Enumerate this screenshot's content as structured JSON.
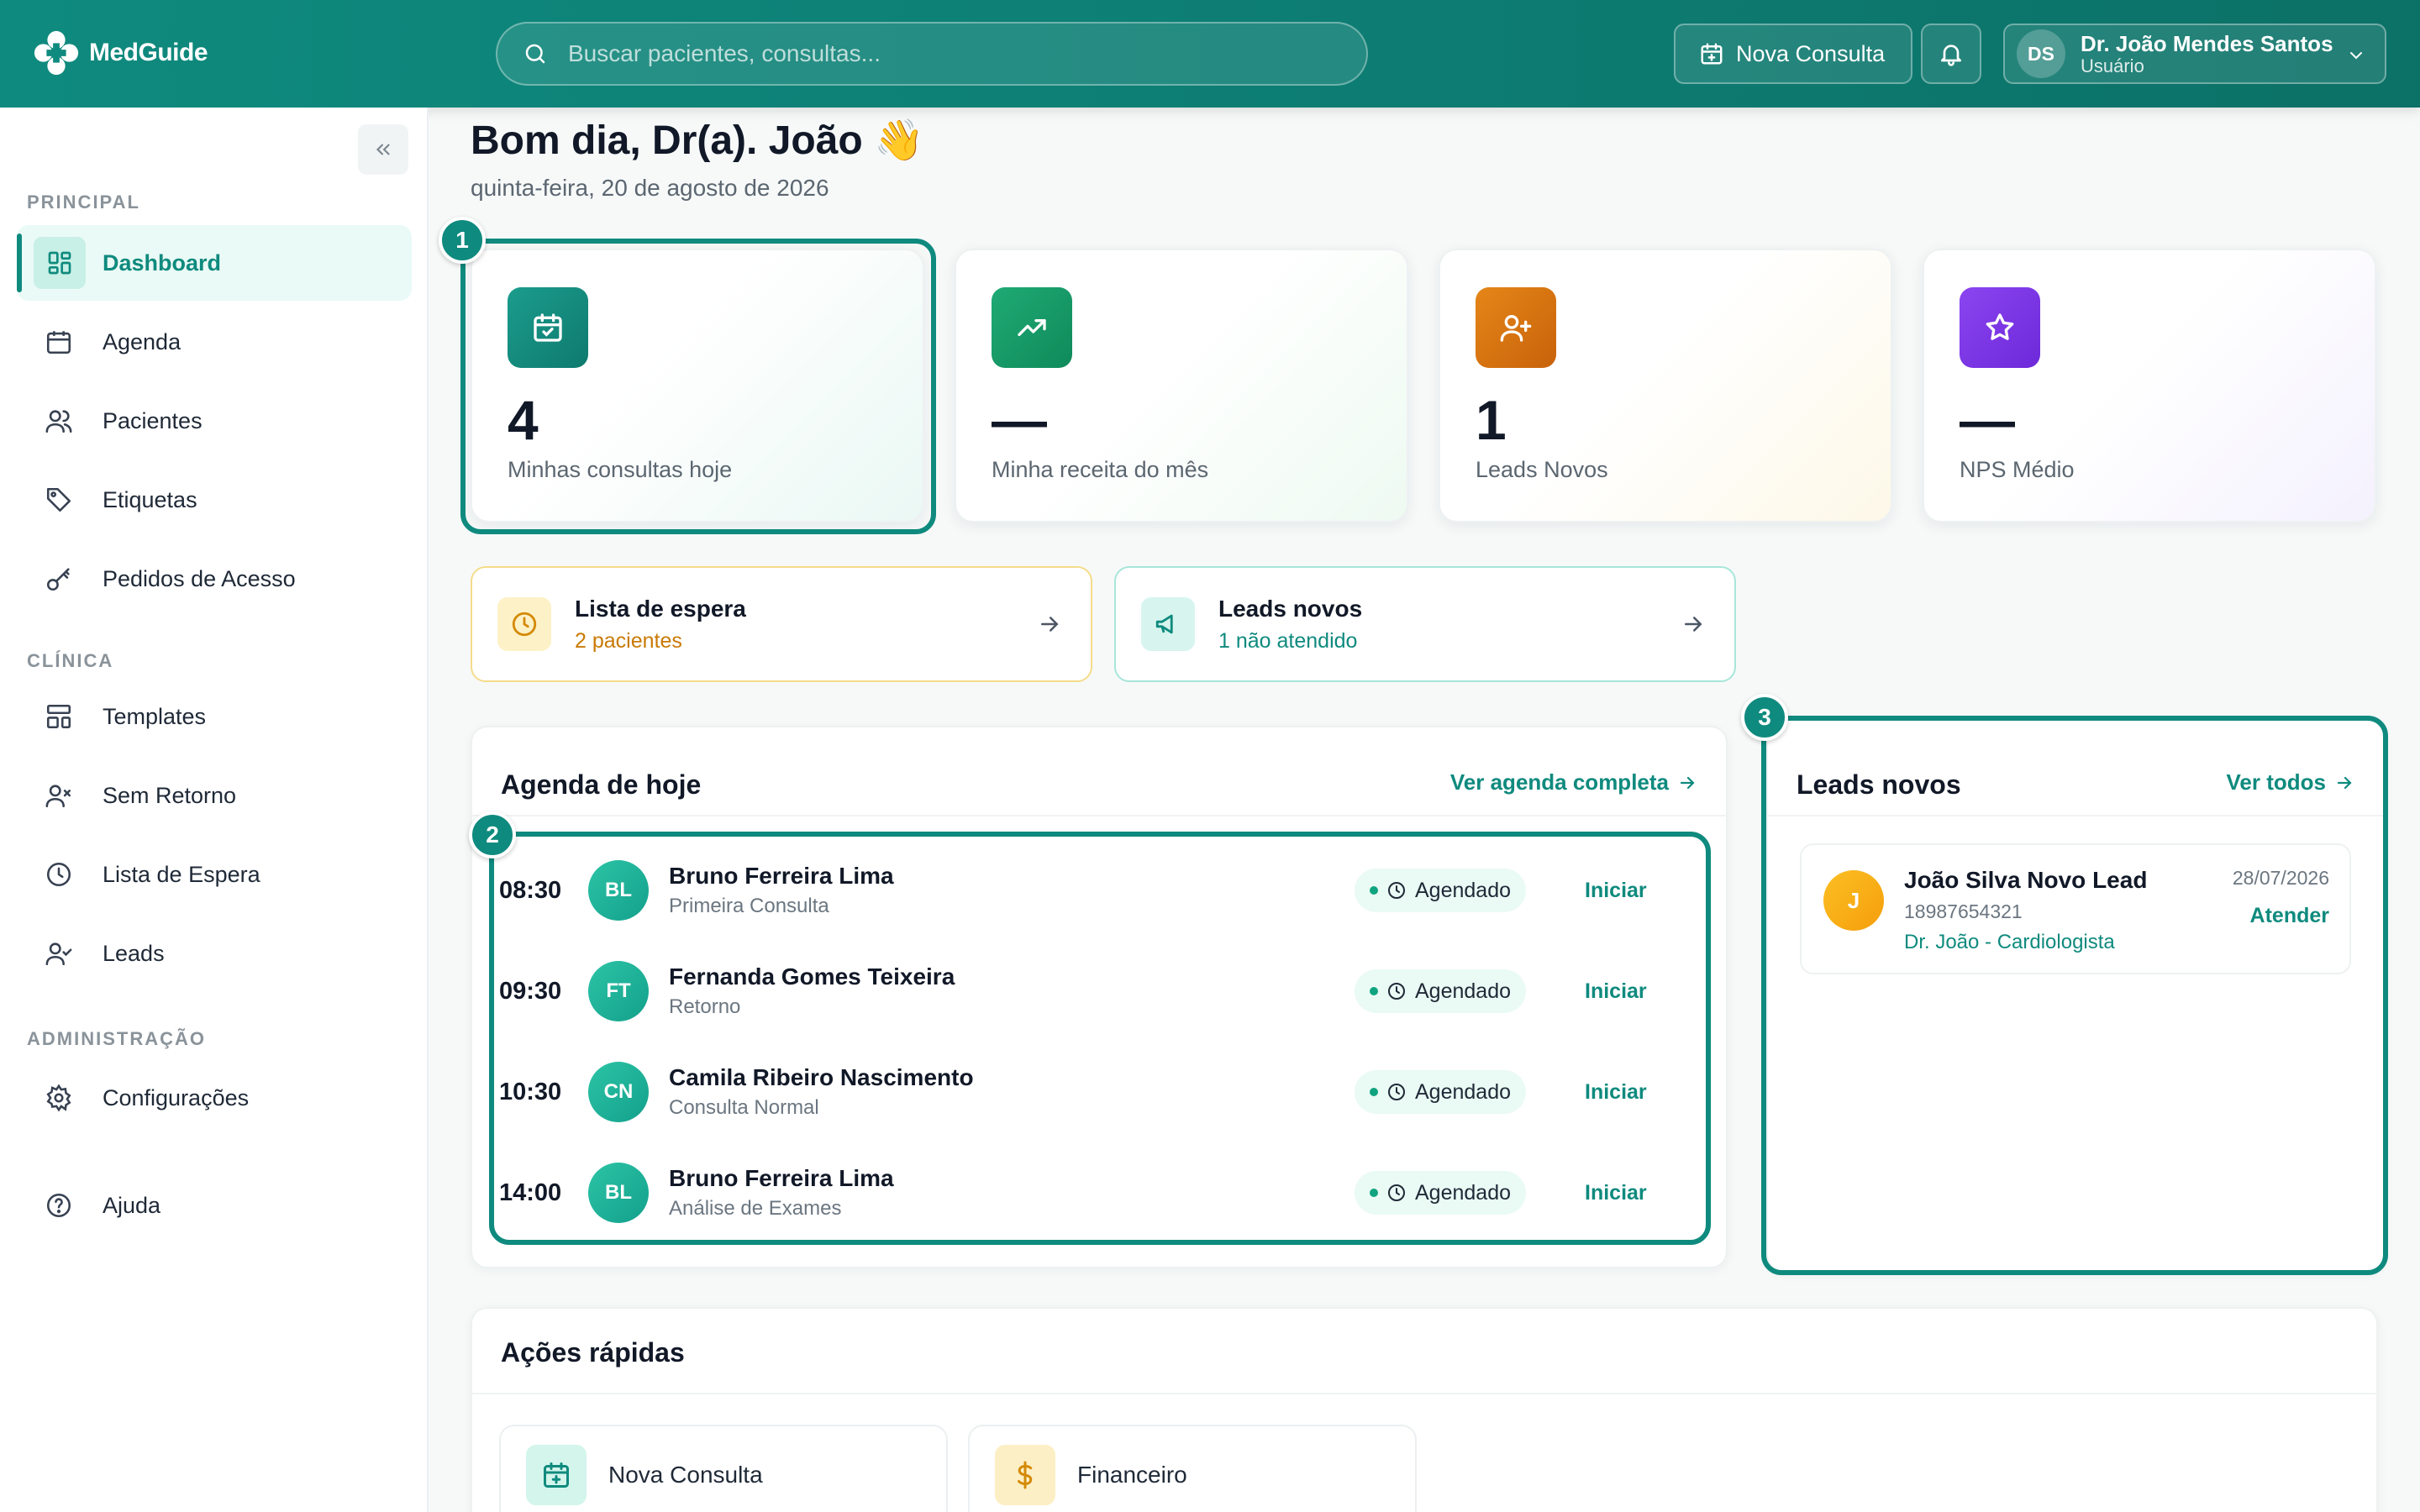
{
  "app": {
    "name": "MedGuide"
  },
  "header": {
    "search_placeholder": "Buscar pacientes, consultas...",
    "new_consult_label": "Nova Consulta",
    "user": {
      "initials": "DS",
      "name": "Dr. João Mendes Santos",
      "role": "Usuário"
    }
  },
  "sidebar": {
    "sections": [
      {
        "label": "PRINCIPAL"
      },
      {
        "label": "CLÍNICA"
      },
      {
        "label": "ADMINISTRAÇÃO"
      }
    ],
    "items": [
      {
        "label": "Dashboard",
        "icon": "dashboard-icon",
        "active": true
      },
      {
        "label": "Agenda",
        "icon": "calendar-icon"
      },
      {
        "label": "Pacientes",
        "icon": "users-icon"
      },
      {
        "label": "Etiquetas",
        "icon": "tag-icon"
      },
      {
        "label": "Pedidos de Acesso",
        "icon": "key-icon"
      },
      {
        "label": "Templates",
        "icon": "template-icon"
      },
      {
        "label": "Sem Retorno",
        "icon": "user-x-icon"
      },
      {
        "label": "Lista de Espera",
        "icon": "clock-icon"
      },
      {
        "label": "Leads",
        "icon": "user-check-icon"
      },
      {
        "label": "Configurações",
        "icon": "gear-icon"
      },
      {
        "label": "Ajuda",
        "icon": "help-icon"
      }
    ]
  },
  "greeting": {
    "title": "Bom dia, Dr(a). João 👋",
    "date": "quinta-feira, 20 de agosto de 2026"
  },
  "stats": [
    {
      "value": "4",
      "label": "Minhas consultas hoje",
      "icon": "calendar-check-icon",
      "color": "#148a7d"
    },
    {
      "value": "—",
      "label": "Minha receita do mês",
      "icon": "trending-up-icon",
      "color": "#149a6a"
    },
    {
      "value": "1",
      "label": "Leads Novos",
      "icon": "user-plus-icon",
      "color": "#d9730d"
    },
    {
      "value": "—",
      "label": "NPS Médio",
      "icon": "star-icon",
      "color": "#7c3aed"
    }
  ],
  "alerts": {
    "waitlist": {
      "title": "Lista de espera",
      "sub": "2 pacientes"
    },
    "leads": {
      "title": "Leads novos",
      "sub": "1 não atendido"
    }
  },
  "agenda": {
    "title": "Agenda de hoje",
    "link": "Ver agenda completa",
    "appointments": [
      {
        "time": "08:30",
        "initials": "BL",
        "name": "Bruno Ferreira Lima",
        "type": "Primeira Consulta",
        "status": "Agendado",
        "action": "Iniciar"
      },
      {
        "time": "09:30",
        "initials": "FT",
        "name": "Fernanda Gomes Teixeira",
        "type": "Retorno",
        "status": "Agendado",
        "action": "Iniciar"
      },
      {
        "time": "10:30",
        "initials": "CN",
        "name": "Camila Ribeiro Nascimento",
        "type": "Consulta Normal",
        "status": "Agendado",
        "action": "Iniciar"
      },
      {
        "time": "14:00",
        "initials": "BL",
        "name": "Bruno Ferreira Lima",
        "type": "Análise de Exames",
        "status": "Agendado",
        "action": "Iniciar"
      }
    ]
  },
  "leads_panel": {
    "title": "Leads novos",
    "link": "Ver todos",
    "lead": {
      "initial": "J",
      "name": "João Silva Novo Lead",
      "phone": "18987654321",
      "doctor": "Dr. João - Cardiologista",
      "date": "28/07/2026",
      "action": "Atender"
    }
  },
  "quick_actions": {
    "title": "Ações rápidas",
    "items": [
      {
        "label": "Nova Consulta"
      },
      {
        "label": "Financeiro"
      }
    ]
  },
  "highlights": [
    "1",
    "2",
    "3"
  ]
}
